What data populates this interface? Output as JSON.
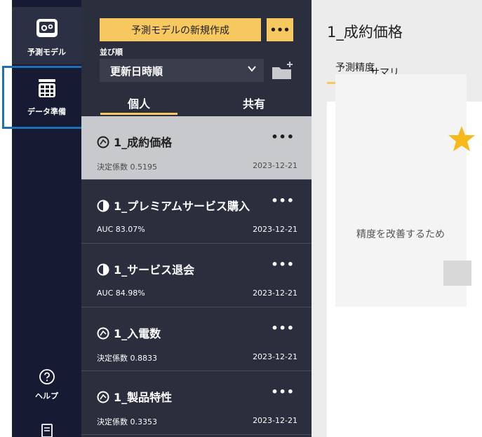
{
  "rail": {
    "items": [
      {
        "label": "予測モデル",
        "icon": "model-gear-icon",
        "active": true
      },
      {
        "label": "データ準備",
        "icon": "table-stack-icon",
        "active": false
      },
      {
        "label": "ヘルプ",
        "icon": "help-circle-icon",
        "active": false
      },
      {
        "label": "",
        "icon": "document-icon",
        "active": false
      }
    ]
  },
  "panel": {
    "new_model_button": "予測モデルの新規作成",
    "more_button": "•••",
    "sort_label": "並び順",
    "sort_value": "更新日時順",
    "tabs": [
      {
        "label": "個人",
        "active": true
      },
      {
        "label": "共有",
        "active": false
      }
    ],
    "models": [
      {
        "name": "1_成約価格",
        "type_icon": "regression-icon",
        "metric": "決定係数 0.5195",
        "date": "2023-12-21",
        "selected": true
      },
      {
        "name": "1_プレミアムサービス購入",
        "type_icon": "half-circle-icon",
        "metric": "AUC 83.07%",
        "date": "2023-12-21",
        "selected": false
      },
      {
        "name": "1_サービス退会",
        "type_icon": "half-circle-icon",
        "metric": "AUC 84.98%",
        "date": "2023-12-21",
        "selected": false
      },
      {
        "name": "1_入電数",
        "type_icon": "regression-icon",
        "metric": "決定係数 0.8833",
        "date": "2023-12-21",
        "selected": false
      },
      {
        "name": "1_製品特性",
        "type_icon": "regression-icon",
        "metric": "決定係数 0.3353",
        "date": "2023-12-21",
        "selected": false
      }
    ],
    "item_more": "•••"
  },
  "main": {
    "title": "1_成約価格",
    "tab": "サマリ",
    "accuracy_label": "予測精度",
    "improve_text": "精度を改善するため"
  },
  "colors": {
    "rail_bg": "#161b33",
    "panel_bg": "#2b2e3d",
    "accent": "#f7c860",
    "focus_outline": "#1f6fb4"
  }
}
